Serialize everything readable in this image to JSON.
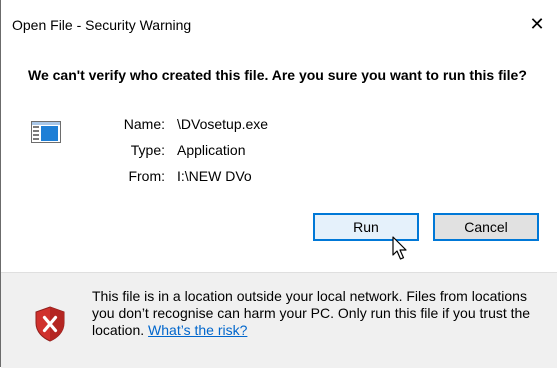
{
  "window": {
    "title": "Open File - Security Warning",
    "close_glyph": "✕"
  },
  "headline": "We can't verify who created this file. Are you sure you want to run this file?",
  "file": {
    "icon": "application-window-icon",
    "rows": [
      {
        "label": "Name:",
        "value": "\\DVosetup.exe"
      },
      {
        "label": "Type:",
        "value": "Application"
      },
      {
        "label": "From:",
        "value": "I:\\NEW DVo"
      }
    ]
  },
  "buttons": {
    "run_label": "Run",
    "cancel_label": "Cancel"
  },
  "warning": {
    "icon": "security-shield-x-icon",
    "text": "This file is in a location outside your local network. Files from locations you don’t recognise can harm your PC. Only run this file if you trust the location.",
    "link_text": "What’s the risk?"
  },
  "colors": {
    "accent": "#0078d7",
    "link": "#0066cc",
    "shield_red": "#d0312d",
    "footer_bg": "#f0f0f0"
  }
}
